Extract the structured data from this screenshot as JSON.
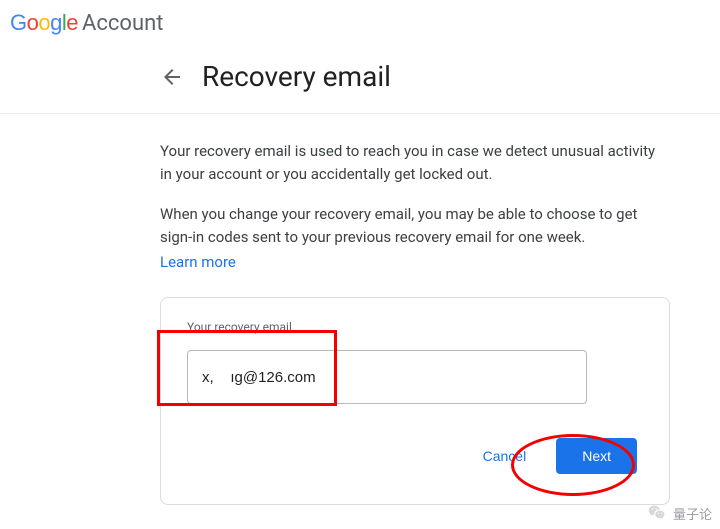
{
  "header": {
    "logo_letters": [
      "G",
      "o",
      "o",
      "g",
      "l",
      "e"
    ],
    "account_label": "Account"
  },
  "page": {
    "title": "Recovery email",
    "desc1": "Your recovery email is used to reach you in case we detect unusual activity in your account or you accidentally get locked out.",
    "desc2": "When you change your recovery email, you may be able to choose to get sign-in codes sent to your previous recovery email for one week.",
    "learn_more": "Learn more"
  },
  "form": {
    "field_label": "Your recovery email",
    "email_value": "x,    ıg@126.com",
    "cancel_label": "Cancel",
    "next_label": "Next"
  },
  "watermark": {
    "text": "量子论"
  }
}
